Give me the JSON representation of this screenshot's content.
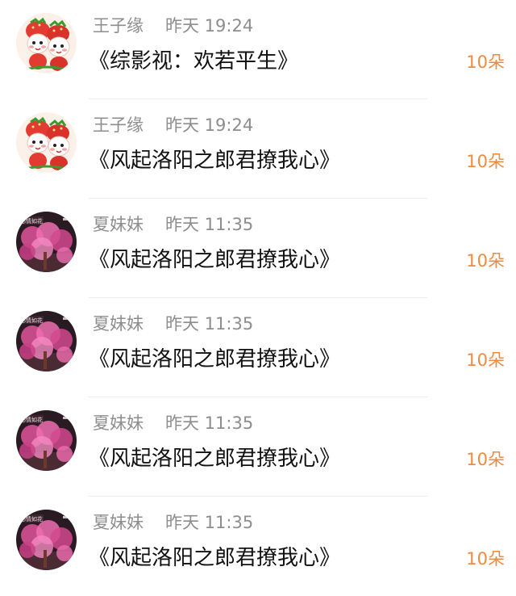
{
  "gifts": [
    {
      "user": "王子缘",
      "time": "昨天 19:24",
      "title": "《综影视：欢若平生》",
      "amount": "10朵",
      "avatar_icon": "strawberry-mascot-icon"
    },
    {
      "user": "王子缘",
      "time": "昨天 19:24",
      "title": "《风起洛阳之郎君撩我心》",
      "amount": "10朵",
      "avatar_icon": "strawberry-mascot-icon"
    },
    {
      "user": "夏妹妹",
      "time": "昨天 11:35",
      "title": "《风起洛阳之郎君撩我心》",
      "amount": "10朵",
      "avatar_icon": "pink-blossom-icon"
    },
    {
      "user": "夏妹妹",
      "time": "昨天 11:35",
      "title": "《风起洛阳之郎君撩我心》",
      "amount": "10朵",
      "avatar_icon": "pink-blossom-icon"
    },
    {
      "user": "夏妹妹",
      "time": "昨天 11:35",
      "title": "《风起洛阳之郎君撩我心》",
      "amount": "10朵",
      "avatar_icon": "pink-blossom-icon"
    },
    {
      "user": "夏妹妹",
      "time": "昨天 11:35",
      "title": "《风起洛阳之郎君撩我心》",
      "amount": "10朵",
      "avatar_icon": "pink-blossom-icon"
    }
  ],
  "colors": {
    "amount": "#f08a3e",
    "meta": "#8d8d8d",
    "title": "#111111"
  }
}
